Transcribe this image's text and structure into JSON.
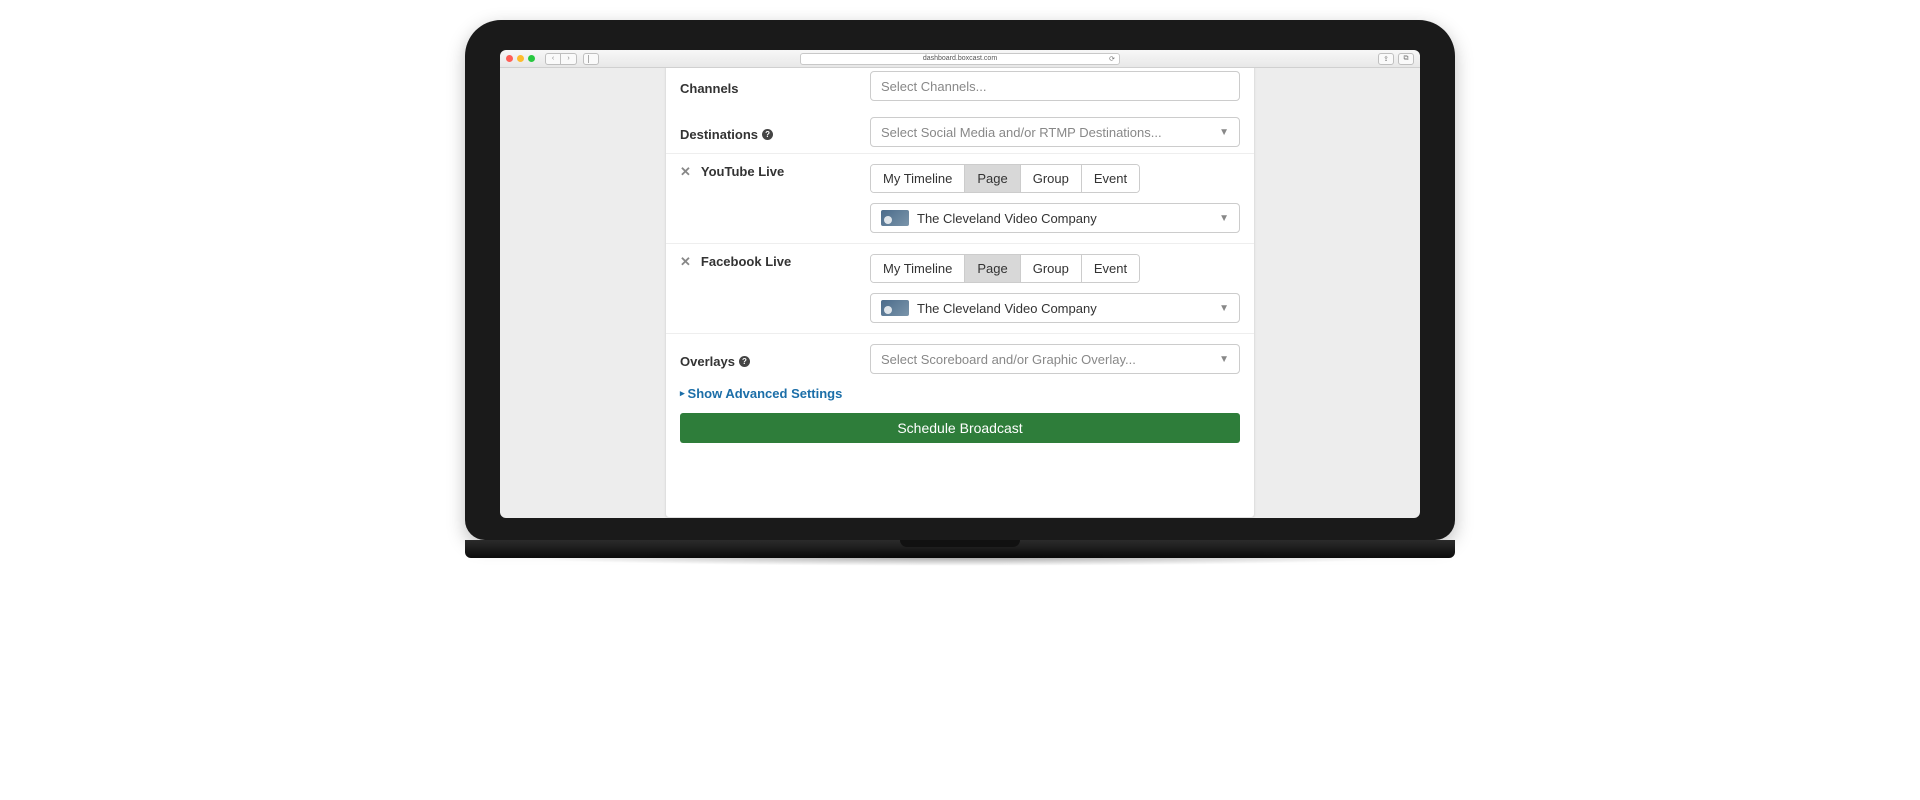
{
  "browser": {
    "url": "dashboard.boxcast.com"
  },
  "form": {
    "channels_label": "Channels",
    "channels_placeholder": "Select Channels...",
    "destinations_label": "Destinations",
    "destinations_placeholder": "Select Social Media and/or RTMP Destinations...",
    "overlays_label": "Overlays",
    "overlays_placeholder": "Select Scoreboard and/or Graphic Overlay...",
    "advanced_link": "Show Advanced Settings",
    "schedule_button": "Schedule Broadcast"
  },
  "tabs": {
    "timeline": "My Timeline",
    "page": "Page",
    "group": "Group",
    "event": "Event"
  },
  "destinations": [
    {
      "name": "YouTube Live",
      "active_tab": "Page",
      "selected_page": "The Cleveland Video Company"
    },
    {
      "name": "Facebook Live",
      "active_tab": "Page",
      "selected_page": "The Cleveland Video Company"
    }
  ]
}
